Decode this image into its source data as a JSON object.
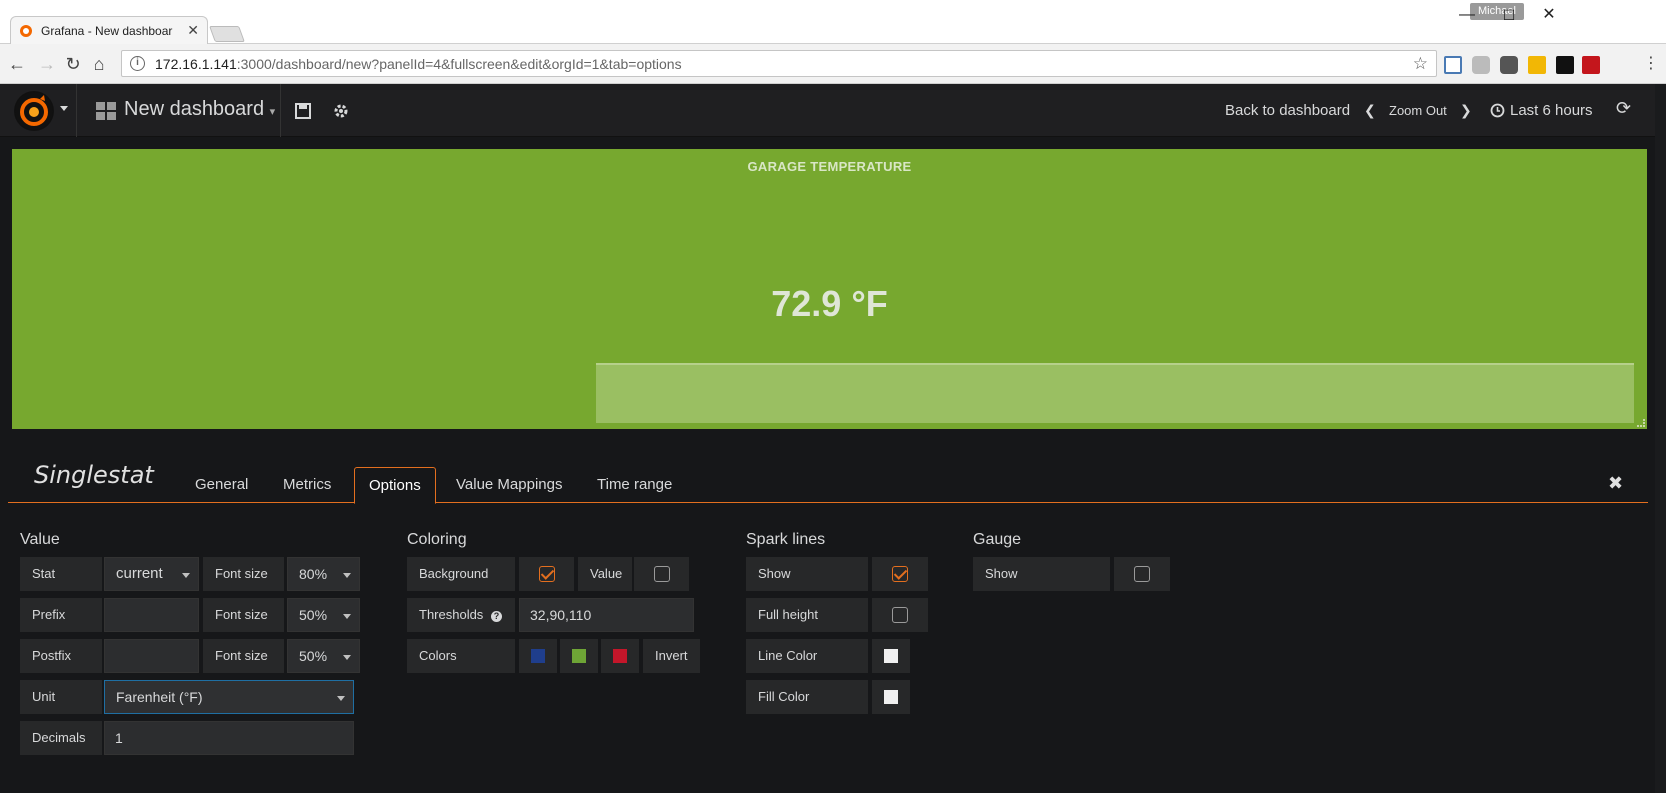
{
  "browser": {
    "tab_title": "Grafana - New dashboar",
    "profile_name": "Michael",
    "url_host": "172.16.1.141",
    "url_path": ":3000/dashboard/new?panelId=4&fullscreen&edit&orgId=1&tab=options"
  },
  "gnav": {
    "dashboard_title": "New dashboard",
    "back_label": "Back to dashboard",
    "zoom_label": "Zoom Out",
    "time_range_label": "Last 6 hours"
  },
  "panel": {
    "title": "GARAGE TEMPERATURE",
    "value": "72.9 °F",
    "background_color": "#77a82f"
  },
  "editor": {
    "title": "Singlestat",
    "tabs": [
      "General",
      "Metrics",
      "Options",
      "Value Mappings",
      "Time range"
    ],
    "active_tab": "Options",
    "value": {
      "section_title": "Value",
      "stat_label": "Stat",
      "stat_value": "current",
      "font_size_label": "Font size",
      "stat_font_size": "80%",
      "prefix_label": "Prefix",
      "prefix_value": "",
      "prefix_font_size": "50%",
      "postfix_label": "Postfix",
      "postfix_value": "",
      "postfix_font_size": "50%",
      "unit_label": "Unit",
      "unit_value": "Farenheit (°F)",
      "decimals_label": "Decimals",
      "decimals_value": "1"
    },
    "coloring": {
      "section_title": "Coloring",
      "background_label": "Background",
      "background_checked": true,
      "value_label": "Value",
      "value_checked": false,
      "thresholds_label": "Thresholds",
      "thresholds_value": "32,90,110",
      "colors_label": "Colors",
      "colors": [
        "#1f3e8c",
        "#6ea536",
        "#c4162a"
      ],
      "invert_label": "Invert"
    },
    "spark_lines": {
      "section_title": "Spark lines",
      "show_label": "Show",
      "show_checked": true,
      "full_height_label": "Full height",
      "full_height_checked": false,
      "line_color_label": "Line Color",
      "fill_color_label": "Fill Color"
    },
    "gauge": {
      "section_title": "Gauge",
      "show_label": "Show",
      "show_checked": false
    }
  },
  "colors": {
    "accent": "#e36f1f",
    "nav_bg": "#1f1f21",
    "page_bg": "#161719"
  }
}
